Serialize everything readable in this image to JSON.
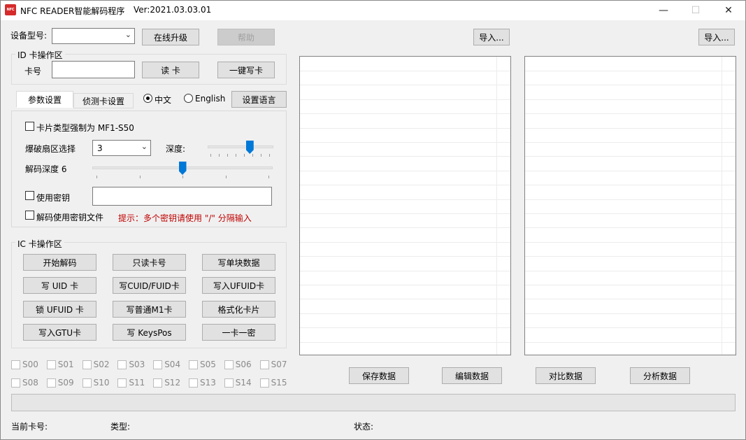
{
  "window": {
    "title": "NFC READER智能解码程序",
    "version": "Ver:2021.03.03.01",
    "app_icon_text": "NFC",
    "minimize_glyph": "—",
    "maximize_glyph": "☐",
    "close_glyph": "✕"
  },
  "top": {
    "device_label": "设备型号:",
    "device_value": "",
    "upgrade_button": "在线升级",
    "help_button": "帮助",
    "import_left": "导入...",
    "import_right": "导入..."
  },
  "id_card": {
    "group_title": "ID 卡操作区",
    "card_label": "卡号",
    "card_value": "",
    "read_button": "读 卡",
    "write_button": "一键写卡"
  },
  "tabs": {
    "params": "参数设置",
    "detect": "侦测卡设置"
  },
  "language": {
    "chinese": "中文",
    "english": "English",
    "selected": "chinese",
    "set_button": "设置语言"
  },
  "params": {
    "force_type_label": "卡片类型强制为 MF1-S50",
    "force_type_checked": false,
    "sector_select_label": "爆破扇区选择",
    "sector_select_value": "3",
    "depth_label": "深度:",
    "depth_level": 0.67,
    "decode_depth_label": "解码深度 6",
    "decode_depth_level": 0.5,
    "use_key_label": "使用密钥",
    "use_key_checked": false,
    "key_value": "",
    "use_key_file_label": "解码使用密钥文件",
    "use_key_file_checked": false,
    "hint": "提示：多个密钥请使用 \"/\" 分隔输入"
  },
  "ic_card": {
    "group_title": "IC 卡操作区",
    "buttons": [
      "开始解码",
      "只读卡号",
      "写单块数据",
      "写 UID 卡",
      "写CUID/FUID卡",
      "写入UFUID卡",
      "锁 UFUID 卡",
      "写普通M1卡",
      "格式化卡片",
      "写入GTU卡",
      "写 KeysPos",
      "一卡一密"
    ]
  },
  "sectors": [
    "S00",
    "S01",
    "S02",
    "S03",
    "S04",
    "S05",
    "S06",
    "S07",
    "S08",
    "S09",
    "S10",
    "S11",
    "S12",
    "S13",
    "S14",
    "S15"
  ],
  "data_buttons": {
    "save": "保存数据",
    "edit": "编辑数据",
    "compare": "对比数据",
    "analyze": "分析数据"
  },
  "status_bar": {
    "card_no_label": "当前卡号:",
    "type_label": "类型:",
    "status_label": "状态:"
  },
  "colors": {
    "accent": "#0078d7",
    "hint": "#c00000",
    "icon": "#d62b2b"
  }
}
